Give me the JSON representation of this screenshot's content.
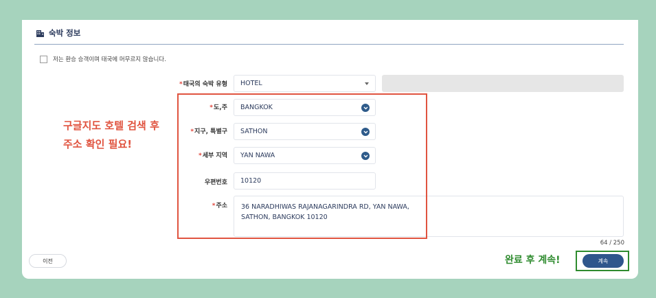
{
  "section": {
    "title": "숙박 정보",
    "transit_checkbox_label": "저는 환승 승객이며 태국에 머무르지 않습니다."
  },
  "form": {
    "accommodation_type": {
      "label": "태국의 숙박 유형",
      "value": "HOTEL"
    },
    "province": {
      "label": "도,주",
      "value": "BANGKOK"
    },
    "district": {
      "label": "지구, 특별구",
      "value": "SATHON"
    },
    "subdistrict": {
      "label": "세부 지역",
      "value": "YAN NAWA"
    },
    "postal_code": {
      "label": "우편번호",
      "value": "10120"
    },
    "address": {
      "label": "주소",
      "line1": "36 NARADHIWAS RAJANAGARINDRA RD, YAN NAWA,",
      "line2": "SATHON, BANGKOK 10120",
      "counter": "64 / 250"
    },
    "required_mark": "*"
  },
  "buttons": {
    "prev": "이전",
    "continue": "계속"
  },
  "annotations": {
    "red_note_line1": "구글지도 호텔 검색 후",
    "red_note_line2": "주소 확인 필요!",
    "green_note": "완료 후 계속!"
  },
  "colors": {
    "background": "#a6d3bd",
    "primary": "#2f568c",
    "required": "#e0443a",
    "annotation_red": "#e0533f",
    "annotation_green": "#2e8b2e"
  },
  "icons": {
    "section": "building-icon",
    "select_arrow": "caret-down-icon",
    "select_circle": "chevron-circle-down-icon"
  }
}
